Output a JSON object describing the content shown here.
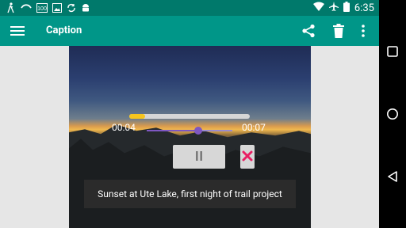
{
  "status_bar": {
    "time": "6:35",
    "left_icons": [
      "hiking-icon",
      "wifi-calling-icon",
      "battery-100-icon",
      "image-icon",
      "sync-icon",
      "android-icon"
    ],
    "battery_label": "100",
    "right_icons": [
      "wifi-icon",
      "airplane-icon",
      "battery-icon"
    ]
  },
  "toolbar": {
    "title": "Caption",
    "menu_icon": "hamburger-menu-icon",
    "actions": [
      "share-icon",
      "delete-icon",
      "more-vert-icon"
    ]
  },
  "player": {
    "loaded_fraction": 0.13,
    "current_time": "00:04",
    "total_time": "00:07",
    "progress_fraction": 0.6,
    "pause_icon": "pause-icon",
    "close_icon": "close-icon",
    "caption": "Sunset at Ute Lake, first night of trail project"
  },
  "nav_bar": {
    "buttons": [
      "recents-icon",
      "home-icon",
      "back-icon"
    ]
  },
  "colors": {
    "status_bar": "#00796b",
    "toolbar": "#009688",
    "seek_accent": "#7e57c2",
    "load_accent": "#f6c51e",
    "close_x": "#e91e63"
  }
}
